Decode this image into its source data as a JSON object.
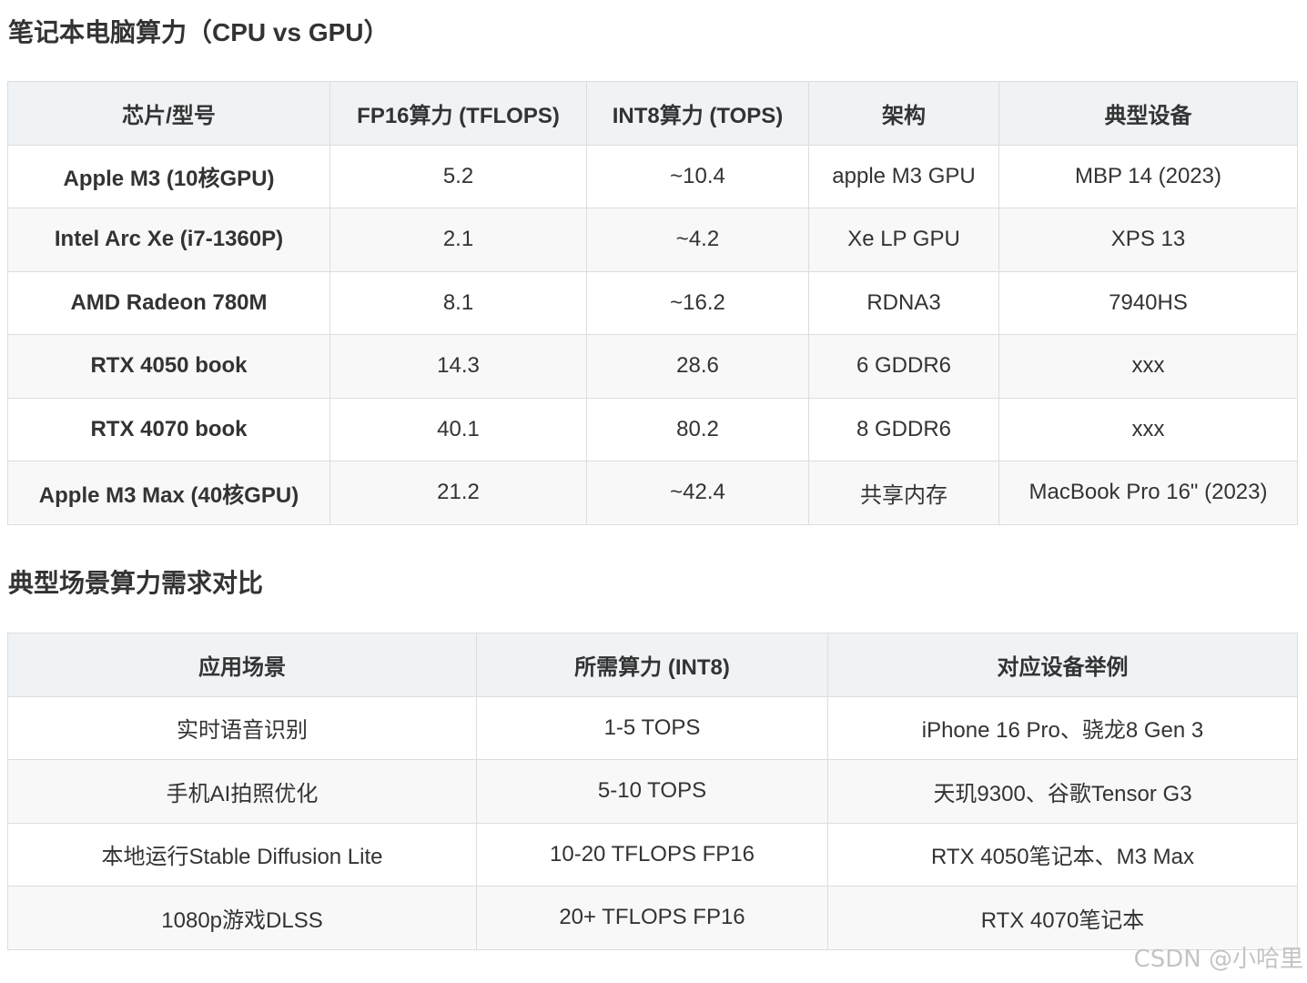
{
  "section1": {
    "title": "笔记本电脑算力（CPU vs GPU）",
    "headers": [
      "芯片/型号",
      "FP16算力 (TFLOPS)",
      "INT8算力 (TOPS)",
      "架构",
      "典型设备"
    ],
    "rows": [
      [
        "Apple M3 (10核GPU)",
        "5.2",
        "~10.4",
        "apple M3 GPU",
        "MBP 14 (2023)"
      ],
      [
        "Intel Arc Xe (i7-1360P)",
        "2.1",
        "~4.2",
        "Xe LP GPU",
        "XPS 13"
      ],
      [
        "AMD Radeon 780M",
        "8.1",
        "~16.2",
        "RDNA3",
        "7940HS"
      ],
      [
        "RTX 4050 book",
        "14.3",
        "28.6",
        "6 GDDR6",
        "xxx"
      ],
      [
        "RTX 4070 book",
        "40.1",
        "80.2",
        "8 GDDR6",
        "xxx"
      ],
      [
        "Apple M3 Max (40核GPU)",
        "21.2",
        "~42.4",
        "共享内存",
        "MacBook Pro 16\" (2023)"
      ]
    ]
  },
  "section2": {
    "title": "典型场景算力需求对比",
    "headers": [
      "应用场景",
      "所需算力 (INT8)",
      "对应设备举例"
    ],
    "rows": [
      [
        "实时语音识别",
        "1-5 TOPS",
        "iPhone 16 Pro、骁龙8 Gen 3"
      ],
      [
        "手机AI拍照优化",
        "5-10 TOPS",
        "天玑9300、谷歌Tensor G3"
      ],
      [
        "本地运行Stable Diffusion Lite",
        "10-20 TFLOPS FP16",
        "RTX 4050笔记本、M3 Max"
      ],
      [
        "1080p游戏DLSS",
        "20+ TFLOPS FP16",
        "RTX 4070笔记本"
      ]
    ]
  },
  "watermark": "CSDN @小哈里"
}
